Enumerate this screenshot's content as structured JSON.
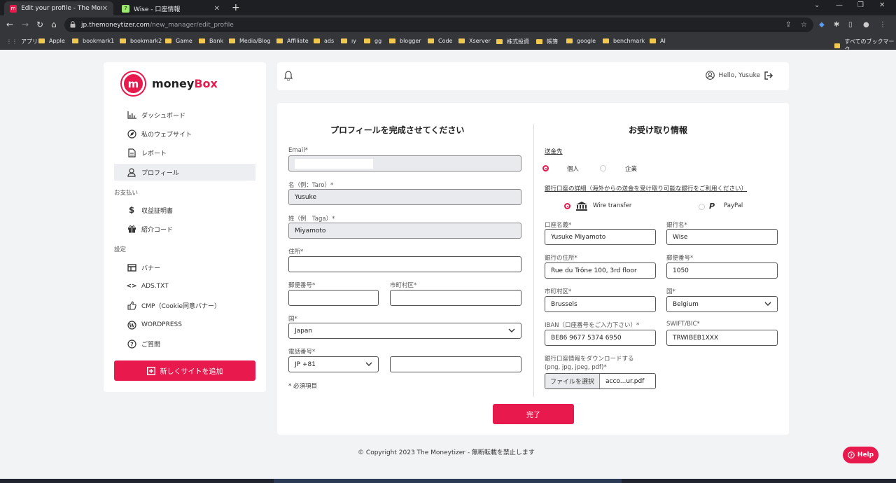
{
  "browser": {
    "tabs": [
      {
        "title": "Edit your profile - The Moneybox",
        "active": true
      },
      {
        "title": "Wise - 口座情報",
        "active": false
      }
    ],
    "url_host": "jp.themoneytizer.com",
    "url_path": "/new_manager/edit_profile",
    "bookmarks": [
      "アプリ",
      "Apple",
      "bookmark1",
      "bookmark2",
      "Game",
      "Bank",
      "Media/Blog",
      "Affiliate",
      "ads",
      "ıy",
      "gg",
      "blogger",
      "Code",
      "Xserver",
      "株式投資",
      "帳簿",
      "google",
      "benchmark",
      "AI"
    ],
    "all_bookmarks": "すべてのブックマーク"
  },
  "sidebar": {
    "brand_mark": "m",
    "brand_a": "money",
    "brand_b": "Box",
    "items": [
      {
        "label": "ダッシュボード",
        "icon": "bar-chart-icon"
      },
      {
        "label": "私のウェブサイト",
        "icon": "compass-icon"
      },
      {
        "label": "レポート",
        "icon": "document-icon"
      },
      {
        "label": "プロフィール",
        "icon": "user-icon",
        "active": true
      }
    ],
    "section_payment": "お支払い",
    "payment_items": [
      {
        "label": "収益証明書",
        "icon": "dollar-icon"
      },
      {
        "label": "紹介コード",
        "icon": "gift-icon"
      }
    ],
    "section_settings": "設定",
    "settings_items": [
      {
        "label": "バナー",
        "icon": "banner-icon"
      },
      {
        "label": "ADS.TXT",
        "icon": "code-icon"
      },
      {
        "label": "CMP（Cookie同意バナー）",
        "icon": "thumbs-up-icon"
      },
      {
        "label": "WORDPRESS",
        "icon": "wordpress-icon"
      },
      {
        "label": "ご質問",
        "icon": "question-icon"
      }
    ],
    "add_site": "新しくサイトを追加"
  },
  "topbar": {
    "greeting": "Hello, Yusuke"
  },
  "profile": {
    "title": "プロフィールを完成させてください",
    "email_label": "Email*",
    "email_value": "",
    "first_name_label": "名（例：Taro）*",
    "first_name_value": "Yusuke",
    "last_name_label": "姓（例　Taga）*",
    "last_name_value": "Miyamoto",
    "address_label": "住所*",
    "address_value": "",
    "postal_label": "郵便番号*",
    "city_label": "市町村区*",
    "country_label": "国*",
    "country_value": "Japan",
    "phone_label": "電話番号*",
    "phone_code": "JP +81",
    "phone_value": "",
    "required_note": "* 必須項目"
  },
  "payout": {
    "title": "お受け取り情報",
    "recipient_label": "送金先",
    "recipient_individual": "個人",
    "recipient_company": "企業",
    "bank_details_label": "銀行口座の詳細（海外からの送金を受け取り可能な銀行をご利用ください）",
    "method_wire": "Wire transfer",
    "method_paypal": "PayPal",
    "account_name_label": "口座名義*",
    "account_name_value": "Yusuke Miyamoto",
    "bank_name_label": "銀行名*",
    "bank_name_value": "Wise",
    "bank_address_label": "銀行の住所*",
    "bank_address_value": "Rue du Trône 100, 3rd floor",
    "bank_postal_label": "郵便番号*",
    "bank_postal_value": "1050",
    "bank_city_label": "市町村区*",
    "bank_city_value": "Brussels",
    "bank_country_label": "国*",
    "bank_country_value": "Belgium",
    "iban_label": "IBAN（口座番号をご入力下さい）*",
    "iban_value": "BE86 9677 5374 6950",
    "swift_label": "SWIFT/BIC*",
    "swift_value": "TRWIBEB1XXX",
    "upload_label_1": "銀行口座情報をダウンロードする",
    "upload_label_2": "(png, jpg, jpeg, pdf)*",
    "choose_file": "ファイルを選択",
    "file_name": "acco...ur.pdf"
  },
  "submit": "完了",
  "footer": "© Copyright 2023 The Moneytizer - 無断転載を禁止します",
  "help": "Help",
  "colors": {
    "brand": "#e8194c",
    "chrome": "#35363a"
  }
}
